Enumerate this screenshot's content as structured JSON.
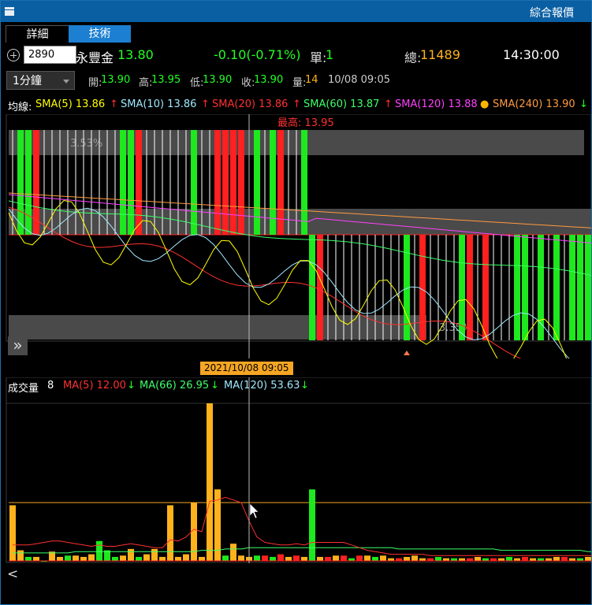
{
  "window": {
    "title": "綜合報價"
  },
  "tabs": [
    {
      "label": "詳細"
    },
    {
      "label": "技術"
    }
  ],
  "quote": {
    "code": "2890",
    "name": "永豐金",
    "price": "13.80",
    "change": "-0.10(-0.71%)",
    "single_label": "單:",
    "single_value": "1",
    "total_label": "總:",
    "total_value": "11489",
    "time": "14:30:00"
  },
  "bar_info": {
    "interval": "1分鐘",
    "open_label": "開:",
    "open": "13.90",
    "high_label": "高:",
    "high": "13.95",
    "low_label": "低:",
    "low": "13.90",
    "close_label": "收:",
    "close": "13.90",
    "vol_label": "量:",
    "vol": "14",
    "datetime": "10/08 09:05"
  },
  "sma": {
    "label": "均線:",
    "items": [
      {
        "text": "SMA(5) 13.86",
        "arrow": "↑",
        "color": "#ffff00",
        "arrow_color": "#ff2a2a"
      },
      {
        "text": "SMA(10) 13.86",
        "arrow": "↑",
        "color": "#9fe8ff",
        "arrow_color": "#ff2a2a"
      },
      {
        "text": "SMA(20) 13.86",
        "arrow": "↑",
        "color": "#ff3030",
        "arrow_color": "#ff2a2a"
      },
      {
        "text": "SMA(60) 13.87",
        "arrow": "↑",
        "color": "#3cff6a",
        "arrow_color": "#ff2a2a"
      },
      {
        "text": "SMA(120) 13.88",
        "arrow": "●",
        "color": "#ff40ff",
        "arrow_color": "#ffb400"
      },
      {
        "text": "SMA(240) 13.90",
        "arrow": "↓",
        "color": "#ff9a40",
        "arrow_color": "#22ff22"
      }
    ]
  },
  "price_chart": {
    "high_label": "最高: 13.95",
    "upper_pct": "3.53%",
    "lower_pct": "3.35%",
    "cursor_date": "2021/10/08 09:05"
  },
  "volume": {
    "label": "成交量",
    "value": "8",
    "items": [
      {
        "text": "MA(5) 12.00",
        "arrow": "↓",
        "color": "#ff3030",
        "arrow_color": "#22ff22"
      },
      {
        "text": "MA(66) 26.95",
        "arrow": "↓",
        "color": "#3cff6a",
        "arrow_color": "#22ff22"
      },
      {
        "text": "MA(120) 53.63",
        "arrow": "↓",
        "color": "#9fe8ff",
        "arrow_color": "#22ff22"
      }
    ]
  },
  "colors": {
    "up": "#ff2020",
    "down": "#1ee81e",
    "neutral": "#ffffff",
    "volume_main": "#ffb21c",
    "accent": "#0a5fa3"
  },
  "chart_data": {
    "type": "bar",
    "series": [
      {
        "name": "成交量",
        "values": [
          42,
          8,
          3,
          3,
          0,
          7,
          3,
          4,
          4,
          3,
          5,
          15,
          8,
          3,
          4,
          9,
          3,
          5,
          9,
          3,
          42,
          3,
          5,
          44,
          3,
          119,
          54,
          4,
          13,
          4,
          3,
          4,
          4,
          3,
          5,
          3,
          4,
          3,
          54,
          3,
          3,
          4,
          4,
          2,
          4,
          4,
          3,
          4,
          2,
          2,
          3,
          4,
          2,
          2,
          3,
          2,
          2,
          2,
          2,
          3,
          2,
          2,
          2,
          3,
          2,
          3,
          2,
          2,
          2,
          3,
          3,
          2,
          2,
          3,
          3,
          2,
          3,
          2,
          2,
          3
        ]
      },
      {
        "name": "MA(5)",
        "values": [
          12,
          12,
          12,
          13,
          14,
          15,
          15,
          14,
          13,
          12,
          11,
          12,
          11,
          11,
          12,
          13,
          12,
          11,
          10,
          10,
          16,
          15,
          18,
          24,
          22,
          45,
          46,
          48,
          46,
          44,
          30,
          18,
          14,
          13,
          12,
          12,
          13,
          12,
          14,
          14,
          14,
          14,
          14,
          12,
          10,
          8,
          7,
          6,
          5,
          5,
          5,
          5,
          5,
          4,
          4,
          4,
          4,
          4,
          4,
          4,
          4,
          4,
          4,
          4,
          4,
          4,
          4,
          4,
          4,
          4,
          4,
          4,
          4,
          4,
          4,
          4,
          4,
          4,
          4,
          4
        ]
      },
      {
        "name": "MA(66)",
        "values": [
          6,
          6,
          6,
          6,
          6,
          6,
          6,
          6,
          7,
          7,
          7,
          7,
          7,
          7,
          7,
          7,
          7,
          7,
          7,
          7,
          7,
          7,
          7,
          7,
          8,
          8,
          8,
          9,
          9,
          9,
          10,
          10,
          10,
          10,
          10,
          10,
          10,
          10,
          10,
          10,
          10,
          10,
          10,
          10,
          10,
          10,
          10,
          10,
          10,
          9,
          9,
          9,
          9,
          9,
          9,
          9,
          9,
          9,
          9,
          9,
          9,
          9,
          8,
          8,
          8,
          8,
          8,
          8,
          8,
          8,
          8,
          8,
          8,
          7,
          7,
          7,
          7,
          7,
          7,
          7
        ]
      }
    ],
    "colors": [
      "o",
      "o",
      "d",
      "o",
      "d",
      "o",
      "o",
      "d",
      "o",
      "o",
      "o",
      "d",
      "d",
      "d",
      "o",
      "o",
      "d",
      "o",
      "o",
      "o",
      "o",
      "o",
      "o",
      "o",
      "o",
      "o",
      "o",
      "d",
      "o",
      "o",
      "o",
      "d",
      "u",
      "d",
      "u",
      "o",
      "u",
      "o",
      "d",
      "o",
      "u",
      "o",
      "u",
      "d",
      "u",
      "o",
      "d",
      "o",
      "o",
      "u",
      "o",
      "o",
      "o",
      "u",
      "d",
      "o",
      "d",
      "o",
      "u",
      "o",
      "d",
      "u",
      "o",
      "d",
      "o",
      "u",
      "o",
      "d",
      "o",
      "o",
      "u",
      "o",
      "d",
      "o",
      "o",
      "d",
      "o",
      "u",
      "o",
      "d"
    ],
    "reference_level": 44,
    "candles_note": "",
    "candles": [
      "n",
      "d",
      "d",
      "u",
      "n",
      "n",
      "n",
      "n",
      "n",
      "n",
      "n",
      "n",
      "n",
      "n",
      "d",
      "d",
      "u",
      "n",
      "n",
      "n",
      "n",
      "n",
      "n",
      "d",
      "n",
      "n",
      "u",
      "u",
      "u",
      "u",
      "n",
      "d",
      "n",
      "d",
      "u",
      "n",
      "n",
      "d",
      "d",
      "u",
      "n",
      "n",
      "n",
      "n",
      "n",
      "n",
      "n",
      "n",
      "n",
      "n",
      "d",
      "n",
      "u",
      "n",
      "n",
      "n",
      "n",
      "d",
      "u",
      "n",
      "u",
      "n",
      "n",
      "n",
      "d",
      "d",
      "n",
      "d",
      "n",
      "d",
      "n",
      "d",
      "d",
      "d",
      "n",
      "n",
      "n",
      "n",
      "n",
      "n"
    ],
    "title": "",
    "xlabel": "",
    "ylabel": ""
  }
}
